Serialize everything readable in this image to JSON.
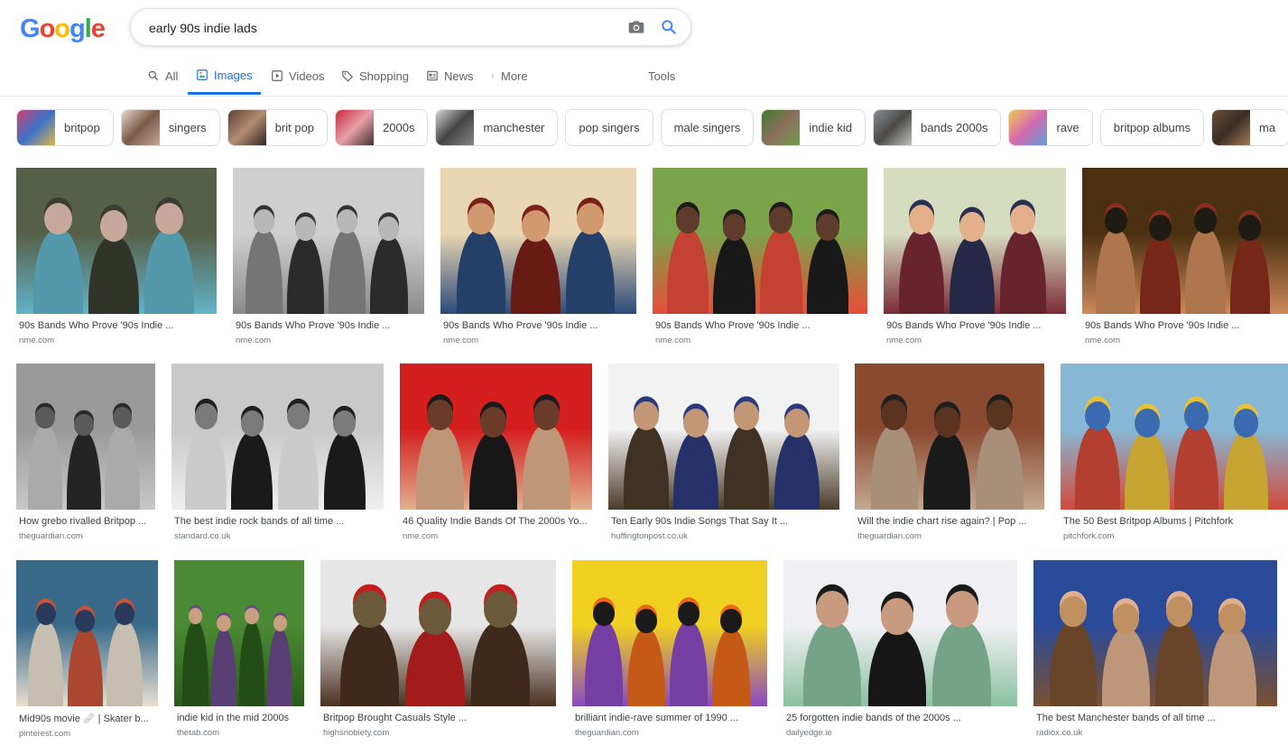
{
  "header": {
    "logo": [
      {
        "ch": "G",
        "color": "#4285F4"
      },
      {
        "ch": "o",
        "color": "#EA4335"
      },
      {
        "ch": "o",
        "color": "#FBBC05"
      },
      {
        "ch": "g",
        "color": "#4285F4"
      },
      {
        "ch": "l",
        "color": "#34A853"
      },
      {
        "ch": "e",
        "color": "#EA4335"
      }
    ],
    "query": "early 90s indie lads",
    "camera_icon": "camera-icon",
    "search_icon": "search-icon"
  },
  "tabs": [
    {
      "label": "All",
      "icon": "search-icon"
    },
    {
      "label": "Images",
      "icon": "image-icon",
      "active": true
    },
    {
      "label": "Videos",
      "icon": "play-icon"
    },
    {
      "label": "Shopping",
      "icon": "tag-icon"
    },
    {
      "label": "News",
      "icon": "news-icon"
    },
    {
      "label": "More",
      "icon": "more-vert-icon"
    },
    {
      "label": "Tools",
      "icon": ""
    }
  ],
  "accent": "#1a73e8",
  "chips": [
    {
      "label": "britpop",
      "thumb": [
        "#d53f6f",
        "#3b72c8",
        "#e6b84a"
      ]
    },
    {
      "label": "singers",
      "thumb": [
        "#e8d9cf",
        "#7a5a48",
        "#c9a898"
      ]
    },
    {
      "label": "brit pop",
      "thumb": [
        "#5a3f33",
        "#b38b72",
        "#2e2522"
      ]
    },
    {
      "label": "2000s",
      "thumb": [
        "#c8243a",
        "#e6a0a6",
        "#3d2f30"
      ]
    },
    {
      "label": "manchester",
      "thumb": [
        "#d8d8d8",
        "#444",
        "#888"
      ]
    },
    {
      "label": "pop singers",
      "thumb": null
    },
    {
      "label": "male singers",
      "thumb": null
    },
    {
      "label": "indie kid",
      "thumb": [
        "#3e7b2c",
        "#8a6e5e",
        "#6fa04a"
      ]
    },
    {
      "label": "bands 2000s",
      "thumb": [
        "#8a8f96",
        "#4c4a47",
        "#c2c2c0"
      ]
    },
    {
      "label": "rave",
      "thumb": [
        "#f2c94c",
        "#d46bb0",
        "#58a0d8"
      ]
    },
    {
      "label": "britpop albums",
      "thumb": null
    },
    {
      "label": "ma",
      "thumb": [
        "#6b4e3a",
        "#3a2d25",
        "#a67c5a"
      ]
    }
  ],
  "results": [
    {
      "caption": "90s Bands Who Prove '90s Indie ...",
      "source": "nme.com",
      "colors": [
        "#566048",
        "#3a3d2f",
        "#63b3c9",
        "#c7a89a"
      ]
    },
    {
      "caption": "90s Bands Who Prove '90s Indie ...",
      "source": "nme.com",
      "colors": [
        "#cfcfcf",
        "#333",
        "#8a8a8a",
        "#b8b8b8"
      ]
    },
    {
      "caption": "90s Bands Who Prove '90s Indie ...",
      "source": "nme.com",
      "colors": [
        "#e9d6b2",
        "#7a2018",
        "#2a4a7a",
        "#d19a6e"
      ]
    },
    {
      "caption": "90s Bands Who Prove '90s Indie ...",
      "source": "nme.com",
      "colors": [
        "#7ba34a",
        "#1c1c1c",
        "#e84d3a",
        "#5e3b2a"
      ]
    },
    {
      "caption": "90s Bands Who Prove '90s Indie ...",
      "source": "nme.com",
      "colors": [
        "#d6dcc0",
        "#2b2f52",
        "#7a2a36",
        "#e3b08b"
      ]
    },
    {
      "caption": "90s Bands Who Prove '90s Indie ...",
      "source": "nme.com",
      "colors": [
        "#4a3010",
        "#8c2e1c",
        "#ce8a5a",
        "#1e1a14"
      ]
    },
    {
      "caption": "How grebo rivalled Britpop ...",
      "source": "theguardian.com",
      "colors": [
        "#9a9a9a",
        "#2a2a2a",
        "#c8c8c8",
        "#5a5a5a"
      ]
    },
    {
      "caption": "The best indie rock bands of all time ...",
      "source": "standard.co.uk",
      "colors": [
        "#c9c9c9",
        "#1e1e1e",
        "#efefef",
        "#7a7a7a"
      ]
    },
    {
      "caption": "46 Quality Indie Bands Of The 2000s Yo...",
      "source": "nme.com",
      "colors": [
        "#d51f1f",
        "#1b1b1b",
        "#e2b08e",
        "#6a3a2a"
      ]
    },
    {
      "caption": "Ten Early 90s Indie Songs That Say It ...",
      "source": "huffingtonpost.co.uk",
      "colors": [
        "#f2f2f2",
        "#2b3a7a",
        "#4a3a2a",
        "#c39676"
      ]
    },
    {
      "caption": "Will the indie chart rise again? | Pop ...",
      "source": "theguardian.com",
      "colors": [
        "#8a4a30",
        "#1f1f1f",
        "#c4a890",
        "#5a3420"
      ]
    },
    {
      "caption": "The 50 Best Britpop Albums | Pitchfork",
      "source": "pitchfork.com",
      "colors": [
        "#86b8d6",
        "#e8c13a",
        "#d24a3a",
        "#3a6ab0"
      ]
    },
    {
      "caption": "Mid90s movie 🩹 | Skater b...",
      "source": "pinterest.com",
      "colors": [
        "#3a6a8a",
        "#c9523a",
        "#e8e0d0",
        "#2a3a5a"
      ]
    },
    {
      "caption": "indie kid in the mid 2000s",
      "source": "thetab.com",
      "colors": [
        "#4a8a34",
        "#6a4a8a",
        "#2a5a1a",
        "#c8a080"
      ]
    },
    {
      "caption": "Britpop Brought Casuals Style ...",
      "source": "highsnobiety.com",
      "colors": [
        "#e6e6e6",
        "#c02020",
        "#4a3020",
        "#6a5a3a"
      ]
    },
    {
      "caption": "brilliant indie-rave summer of 1990 ...",
      "source": "theguardian.com",
      "colors": [
        "#f0d020",
        "#e86a1a",
        "#8a4ac0",
        "#1a1a1a"
      ]
    },
    {
      "caption": "25 forgotten indie bands of the 2000s ...",
      "source": "dailyedge.ie",
      "colors": [
        "#f0f0f4",
        "#1a1a1a",
        "#8ac0a0",
        "#c89a80"
      ]
    },
    {
      "caption": "The best Manchester bands of all time ...",
      "source": "radiox.co.uk",
      "colors": [
        "#2a4a9a",
        "#e0b090",
        "#7a5030",
        "#c09060"
      ]
    }
  ]
}
